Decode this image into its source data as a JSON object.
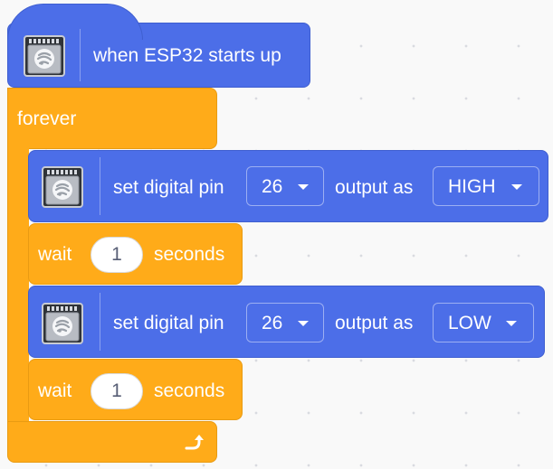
{
  "hat_block": {
    "label": "when ESP32 starts up",
    "icon": "esp32-chip-icon"
  },
  "forever_block": {
    "label": "forever",
    "loop_icon": "loop-arrow-icon"
  },
  "blocks": [
    {
      "type": "set_digital_pin",
      "label": "set digital pin",
      "pin": "26",
      "mid_label": "output as",
      "level": "HIGH"
    },
    {
      "type": "wait",
      "label": "wait",
      "value": "1",
      "unit": "seconds"
    },
    {
      "type": "set_digital_pin",
      "label": "set digital pin",
      "pin": "26",
      "mid_label": "output as",
      "level": "LOW"
    },
    {
      "type": "wait",
      "label": "wait",
      "value": "1",
      "unit": "seconds"
    }
  ],
  "colors": {
    "motion_blue": "#4c6ee8",
    "control_orange": "#ffab19",
    "canvas": "#f9f9f9"
  }
}
